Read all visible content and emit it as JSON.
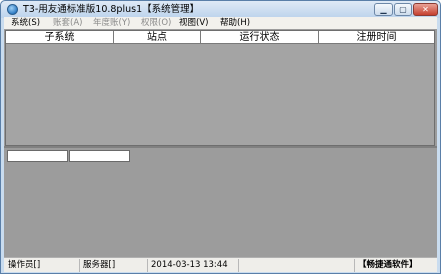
{
  "window": {
    "title": "T3-用友通标准版10.8plus1【系统管理】",
    "minimize_label": "▁",
    "maximize_label": "▢",
    "close_label": "✕"
  },
  "menubar": {
    "items": [
      {
        "label": "系统(S)",
        "enabled": true
      },
      {
        "label": "账套(A)",
        "enabled": false
      },
      {
        "label": "年度账(Y)",
        "enabled": false
      },
      {
        "label": "权限(O)",
        "enabled": false
      },
      {
        "label": "视图(V)",
        "enabled": true
      },
      {
        "label": "帮助(H)",
        "enabled": true
      }
    ]
  },
  "grid_top": {
    "columns": [
      "子系统",
      "站点",
      "运行状态",
      "注册时间"
    ],
    "rows": []
  },
  "grid_bottom": {
    "cells": [
      "",
      ""
    ]
  },
  "statusbar": {
    "operator": "操作员[]",
    "server": "服务器[]",
    "datetime": "2014-03-13 13:44",
    "blank": "",
    "vendor": "【畅捷通软件】"
  },
  "colors": {
    "grid_background": "#a4a4a4",
    "titlebar": "#bcd3ec",
    "menubar": "#f2f1ed"
  }
}
